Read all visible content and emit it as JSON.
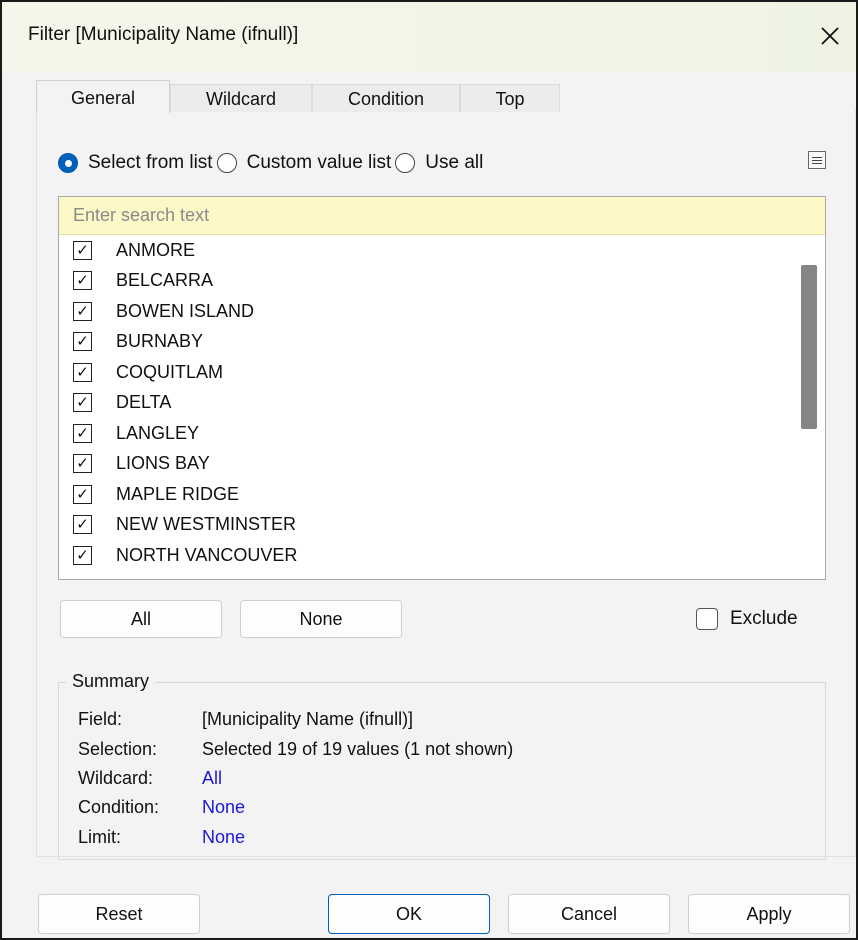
{
  "window": {
    "title": "Filter [Municipality Name (ifnull)]",
    "close_icon": "close-icon"
  },
  "tabs": [
    {
      "label": "General",
      "active": true
    },
    {
      "label": "Wildcard",
      "active": false
    },
    {
      "label": "Condition",
      "active": false
    },
    {
      "label": "Top",
      "active": false
    }
  ],
  "mode": {
    "options": [
      {
        "label": "Select from list",
        "selected": true
      },
      {
        "label": "Custom value list",
        "selected": false
      },
      {
        "label": "Use all",
        "selected": false
      }
    ],
    "menu_icon": "list-menu-icon"
  },
  "search": {
    "placeholder": "Enter search text",
    "value": ""
  },
  "list": {
    "items": [
      {
        "label": "ANMORE",
        "checked": true
      },
      {
        "label": "BELCARRA",
        "checked": true
      },
      {
        "label": "BOWEN ISLAND",
        "checked": true
      },
      {
        "label": "BURNABY",
        "checked": true
      },
      {
        "label": "COQUITLAM",
        "checked": true
      },
      {
        "label": "DELTA",
        "checked": true
      },
      {
        "label": "LANGLEY",
        "checked": true
      },
      {
        "label": "LIONS BAY",
        "checked": true
      },
      {
        "label": "MAPLE RIDGE",
        "checked": true
      },
      {
        "label": "NEW WESTMINSTER",
        "checked": true
      },
      {
        "label": "NORTH VANCOUVER",
        "checked": true
      }
    ],
    "check_glyph": "✓"
  },
  "list_buttons": {
    "all_label": "All",
    "none_label": "None",
    "exclude_label": "Exclude",
    "exclude_checked": false
  },
  "summary": {
    "legend": "Summary",
    "field_key": "Field:",
    "field_val": "[Municipality Name (ifnull)]",
    "selection_key": "Selection:",
    "selection_val": "Selected 19 of 19 values (1 not shown)",
    "wildcard_key": "Wildcard:",
    "wildcard_val": "All",
    "condition_key": "Condition:",
    "condition_val": "None",
    "limit_key": "Limit:",
    "limit_val": "None"
  },
  "footer": {
    "reset_label": "Reset",
    "ok_label": "OK",
    "cancel_label": "Cancel",
    "apply_label": "Apply"
  },
  "colors": {
    "accent": "#005fb8",
    "link": "#1a1ad6",
    "search_bg": "#fcf8c8"
  }
}
